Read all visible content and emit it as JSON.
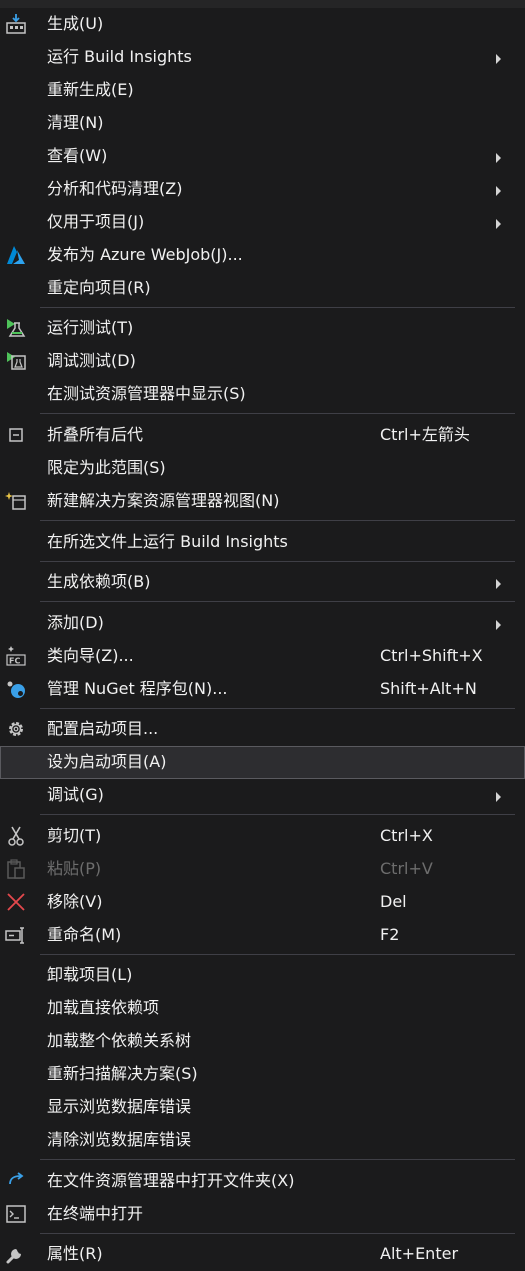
{
  "menu": {
    "items": {
      "build": {
        "label": "生成(U)",
        "icon": "build-icon"
      },
      "run_build_insights": {
        "label": "运行 Build Insights"
      },
      "rebuild": {
        "label": "重新生成(E)"
      },
      "clean": {
        "label": "清理(N)"
      },
      "view": {
        "label": "查看(W)"
      },
      "analyze": {
        "label": "分析和代码清理(Z)"
      },
      "project_only": {
        "label": "仅用于项目(J)"
      },
      "publish_azure": {
        "label": "发布为 Azure WebJob(J)...",
        "icon": "azure-icon"
      },
      "retarget": {
        "label": "重定向项目(R)"
      },
      "run_tests": {
        "label": "运行测试(T)",
        "icon": "run-tests-icon"
      },
      "debug_tests": {
        "label": "调试测试(D)",
        "icon": "debug-tests-icon"
      },
      "show_test_explorer": {
        "label": "在测试资源管理器中显示(S)"
      },
      "collapse_all": {
        "label": "折叠所有后代",
        "shortcut": "Ctrl+左箭头",
        "icon": "collapse-icon"
      },
      "scope_to_this": {
        "label": "限定为此范围(S)"
      },
      "new_solution_view": {
        "label": "新建解决方案资源管理器视图(N)",
        "icon": "new-view-icon"
      },
      "run_build_insights_selected": {
        "label": "在所选文件上运行 Build Insights"
      },
      "build_dependencies": {
        "label": "生成依赖项(B)"
      },
      "add": {
        "label": "添加(D)"
      },
      "class_wizard": {
        "label": "类向导(Z)...",
        "shortcut": "Ctrl+Shift+X",
        "icon": "class-wizard-icon"
      },
      "manage_nuget": {
        "label": "管理 NuGet 程序包(N)...",
        "shortcut": "Shift+Alt+N",
        "icon": "nuget-icon"
      },
      "configure_startup": {
        "label": "配置启动项目...",
        "icon": "gear-icon"
      },
      "set_startup": {
        "label": "设为启动项目(A)"
      },
      "debug": {
        "label": "调试(G)"
      },
      "cut": {
        "label": "剪切(T)",
        "shortcut": "Ctrl+X",
        "icon": "scissors-icon"
      },
      "paste": {
        "label": "粘贴(P)",
        "shortcut": "Ctrl+V",
        "icon": "paste-icon"
      },
      "remove": {
        "label": "移除(V)",
        "shortcut": "Del",
        "icon": "remove-icon"
      },
      "rename": {
        "label": "重命名(M)",
        "shortcut": "F2",
        "icon": "rename-icon"
      },
      "unload_project": {
        "label": "卸载项目(L)"
      },
      "load_direct_deps": {
        "label": "加载直接依赖项"
      },
      "load_dep_tree": {
        "label": "加载整个依赖关系树"
      },
      "rescan_solution": {
        "label": "重新扫描解决方案(S)"
      },
      "show_browse_db_errors": {
        "label": "显示浏览数据库错误"
      },
      "clear_browse_db_errors": {
        "label": "清除浏览数据库错误"
      },
      "open_in_explorer": {
        "label": "在文件资源管理器中打开文件夹(X)",
        "icon": "open-folder-icon"
      },
      "open_in_terminal": {
        "label": "在终端中打开",
        "icon": "terminal-icon"
      },
      "properties": {
        "label": "属性(R)",
        "shortcut": "Alt+Enter",
        "icon": "wrench-icon"
      }
    }
  },
  "colors": {
    "background": "#1b1b1c",
    "text": "#f1f1f1",
    "disabled_text": "#6d6d6d",
    "separator": "#3f3f46",
    "hover_bg": "#2d2d30",
    "hover_border": "#5a5a5f",
    "azure_blue": "#0089d6",
    "test_green": "#4fc35a",
    "remove_red": "#e5484d",
    "nuget_blue": "#3aa0e8"
  }
}
